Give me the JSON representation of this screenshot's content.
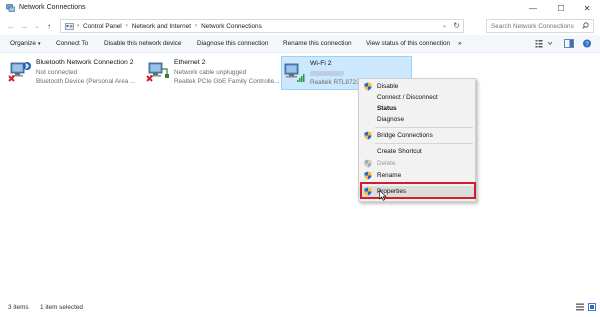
{
  "window": {
    "title": "Network Connections",
    "minimize": "—",
    "maximize": "☐",
    "close": "✕"
  },
  "nav": {
    "back": "←",
    "forward": "→",
    "down": "⌄",
    "up": "↑"
  },
  "address": {
    "crumbs": [
      "Control Panel",
      "Network and Internet",
      "Network Connections"
    ],
    "sep": "›",
    "dropdown": "⌄",
    "refresh": "↻"
  },
  "search": {
    "placeholder": "Search Network Connections"
  },
  "commands": {
    "organize": "Organize",
    "organize_caret": "▾",
    "connect_to": "Connect To",
    "disable": "Disable this network device",
    "diagnose": "Diagnose this connection",
    "rename": "Rename this connection",
    "view_status": "View status of this connection",
    "more": "»"
  },
  "connections": [
    {
      "name": "Bluetooth Network Connection 2",
      "status": "Not connected",
      "device": "Bluetooth Device (Personal Area ..."
    },
    {
      "name": "Ethernet 2",
      "status": "Network cable unplugged",
      "device": "Realtek PCIe GbE Family Controlle..."
    },
    {
      "name": "Wi-Fi 2",
      "status": "",
      "device": "Realtek RTL8723D..."
    }
  ],
  "context_menu": {
    "disable": "Disable",
    "connect": "Connect / Disconnect",
    "status": "Status",
    "diagnose": "Diagnose",
    "bridge": "Bridge Connections",
    "shortcut": "Create Shortcut",
    "delete": "Delete",
    "rename": "Rename",
    "properties": "Properties"
  },
  "statusbar": {
    "items": "3 items",
    "selected": "1 item selected"
  },
  "colors": {
    "selection": "#cce8ff",
    "highlight_box": "#d11f29",
    "error_x": "#d9202a"
  }
}
